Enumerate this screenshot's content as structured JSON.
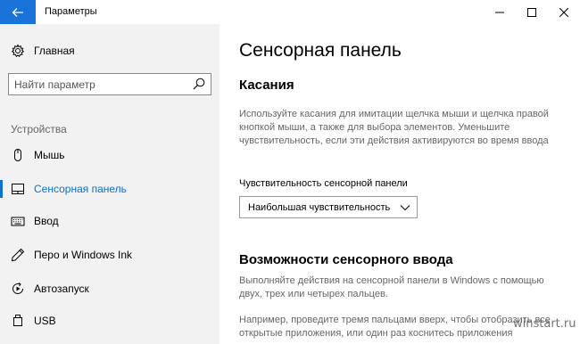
{
  "window": {
    "title": "Параметры",
    "accent": "#1a73d9"
  },
  "sidebar": {
    "home": {
      "label": "Главная",
      "icon": "gear-icon"
    },
    "search": {
      "placeholder": "Найти параметр",
      "value": ""
    },
    "section_label": "Устройства",
    "items": [
      {
        "label": "Мышь",
        "icon": "mouse-icon",
        "active": false
      },
      {
        "label": "Сенсорная панель",
        "icon": "touchpad-icon",
        "active": true
      },
      {
        "label": "Ввод",
        "icon": "keyboard-icon",
        "active": false
      },
      {
        "label": "Перо и Windows Ink",
        "icon": "pen-icon",
        "active": false
      },
      {
        "label": "Автозапуск",
        "icon": "autoplay-icon",
        "active": false
      },
      {
        "label": "USB",
        "icon": "usb-icon",
        "active": false
      }
    ],
    "active_color": "#0f6fcc"
  },
  "main": {
    "page_title": "Сенсорная панель",
    "touches": {
      "title": "Касания",
      "description": "Используйте касания для имитации щелчка мыши и щелчка правой кнопкой мыши, а также для выбора элементов. Уменьшите чувствительность, если эти действия активируются во время ввода",
      "sensitivity_label": "Чувствительность сенсорной панели",
      "sensitivity_value": "Наибольшая чувствительность"
    },
    "gestures": {
      "title": "Возможности сенсорного ввода",
      "description": "Выполняйте действия на сенсорной панели в Windows с помощью двух, трех или четырех пальцев.",
      "example": "Например, проведите тремя пальцами вверх, чтобы отобразить все открытые приложения, или один раз коснитесь приложения"
    }
  },
  "watermark": "winstart.ru"
}
